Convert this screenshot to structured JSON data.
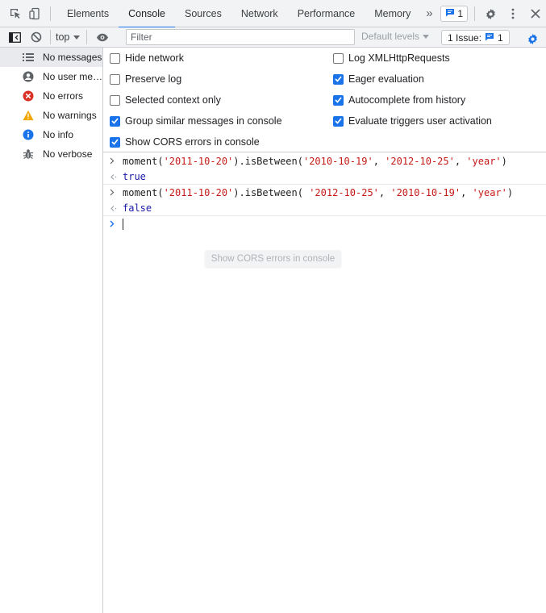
{
  "tabbar": {
    "tabs": [
      "Elements",
      "Console",
      "Sources",
      "Network",
      "Performance",
      "Memory"
    ],
    "active_tab": "Console",
    "more_glyph": "»",
    "messages_count": "1"
  },
  "toolbar": {
    "context": "top",
    "filter_placeholder": "Filter",
    "levels_label": "Default levels",
    "issue_label": "1 Issue:",
    "issue_count": "1"
  },
  "sidebar": {
    "items": [
      {
        "label": "No messages",
        "icon": "list-icon"
      },
      {
        "label": "No user me…",
        "icon": "user-icon"
      },
      {
        "label": "No errors",
        "icon": "error-icon"
      },
      {
        "label": "No warnings",
        "icon": "warning-icon"
      },
      {
        "label": "No info",
        "icon": "info-icon"
      },
      {
        "label": "No verbose",
        "icon": "bug-icon"
      }
    ]
  },
  "settings": {
    "left": [
      {
        "label": "Hide network",
        "checked": false
      },
      {
        "label": "Preserve log",
        "checked": false
      },
      {
        "label": "Selected context only",
        "checked": false
      },
      {
        "label": "Group similar messages in console",
        "checked": true
      },
      {
        "label": "Show CORS errors in console",
        "checked": true
      }
    ],
    "right": [
      {
        "label": "Log XMLHttpRequests",
        "checked": false
      },
      {
        "label": "Eager evaluation",
        "checked": true
      },
      {
        "label": "Autocomplete from history",
        "checked": true
      },
      {
        "label": "Evaluate triggers user activation",
        "checked": true
      }
    ]
  },
  "console": {
    "entries": [
      {
        "input": {
          "fn": "moment(",
          "d1": "'2011-10-20'",
          "mid": ").isBetween(",
          "a1": "'2010-10-19'",
          "c1": ", ",
          "a2": "'2012-10-25'",
          "c2": ", ",
          "a3": "'year'",
          "end": ")"
        },
        "result": "true"
      },
      {
        "input": {
          "fn": "moment(",
          "d1": "'2011-10-20'",
          "mid": ").isBetween( ",
          "a1": "'2012-10-25'",
          "c1": ", ",
          "a2": "'2010-10-19'",
          "c2": ", ",
          "a3": "'year'",
          "end": ")"
        },
        "result": "false"
      }
    ],
    "input_prompt": ">",
    "output_prompt": "<·"
  },
  "tooltip": "Show CORS errors in console"
}
